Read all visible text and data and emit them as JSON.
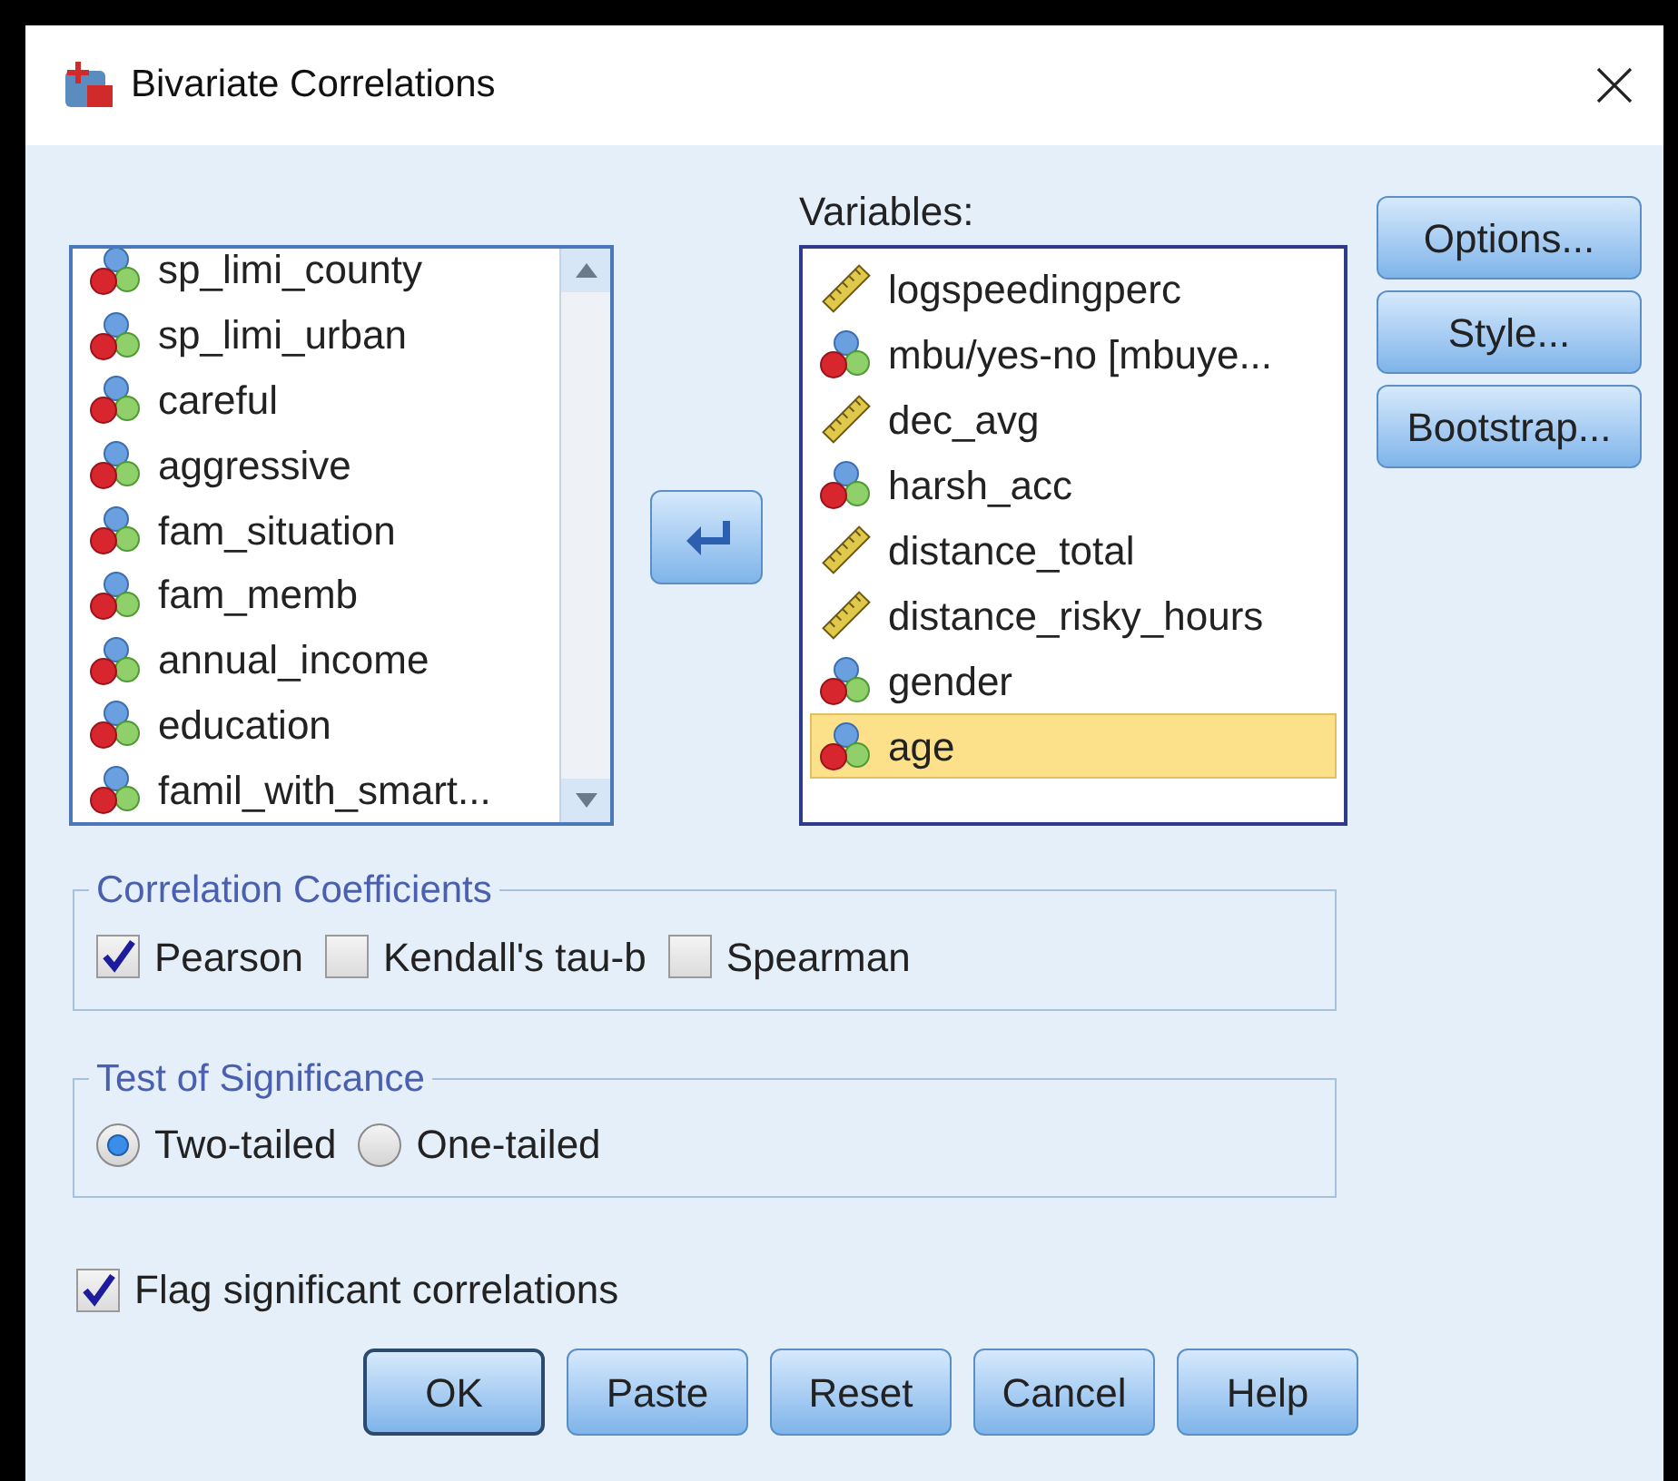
{
  "window": {
    "title": "Bivariate Correlations"
  },
  "source_list": {
    "items": [
      {
        "label": "sp_limi_county",
        "kind": "nominal",
        "selected": false
      },
      {
        "label": "sp_limi_urban",
        "kind": "nominal",
        "selected": false
      },
      {
        "label": "careful",
        "kind": "nominal",
        "selected": false
      },
      {
        "label": "aggressive",
        "kind": "nominal",
        "selected": false
      },
      {
        "label": "fam_situation",
        "kind": "nominal",
        "selected": false
      },
      {
        "label": "fam_memb",
        "kind": "nominal",
        "selected": false
      },
      {
        "label": "annual_income",
        "kind": "nominal",
        "selected": false
      },
      {
        "label": "education",
        "kind": "nominal",
        "selected": false
      },
      {
        "label": "famil_with_smart...",
        "kind": "nominal",
        "selected": false
      }
    ]
  },
  "variables": {
    "label": "Variables:",
    "items": [
      {
        "label": "logspeedingperc",
        "kind": "scale",
        "selected": false
      },
      {
        "label": "mbu/yes-no [mbuye...",
        "kind": "nominal",
        "selected": false
      },
      {
        "label": "dec_avg",
        "kind": "scale",
        "selected": false
      },
      {
        "label": "harsh_acc",
        "kind": "nominal",
        "selected": false
      },
      {
        "label": "distance_total",
        "kind": "scale",
        "selected": false
      },
      {
        "label": "distance_risky_hours",
        "kind": "scale",
        "selected": false
      },
      {
        "label": "gender",
        "kind": "nominal",
        "selected": false
      },
      {
        "label": "age",
        "kind": "nominal",
        "selected": true
      }
    ]
  },
  "side_buttons": [
    "Options...",
    "Style...",
    "Bootstrap..."
  ],
  "correlation_coefficients": {
    "title": "Correlation Coefficients",
    "options": [
      {
        "label": "Pearson",
        "checked": true
      },
      {
        "label": "Kendall's tau-b",
        "checked": false
      },
      {
        "label": "Spearman",
        "checked": false
      }
    ]
  },
  "test_of_significance": {
    "title": "Test of Significance",
    "options": [
      {
        "label": "Two-tailed",
        "selected": true
      },
      {
        "label": "One-tailed",
        "selected": false
      }
    ]
  },
  "flag_significant": {
    "label": "Flag significant correlations",
    "checked": true
  },
  "buttons": [
    {
      "label": "OK",
      "default": true
    },
    {
      "label": "Paste",
      "default": false
    },
    {
      "label": "Reset",
      "default": false
    },
    {
      "label": "Cancel",
      "default": false
    },
    {
      "label": "Help",
      "default": false
    }
  ]
}
